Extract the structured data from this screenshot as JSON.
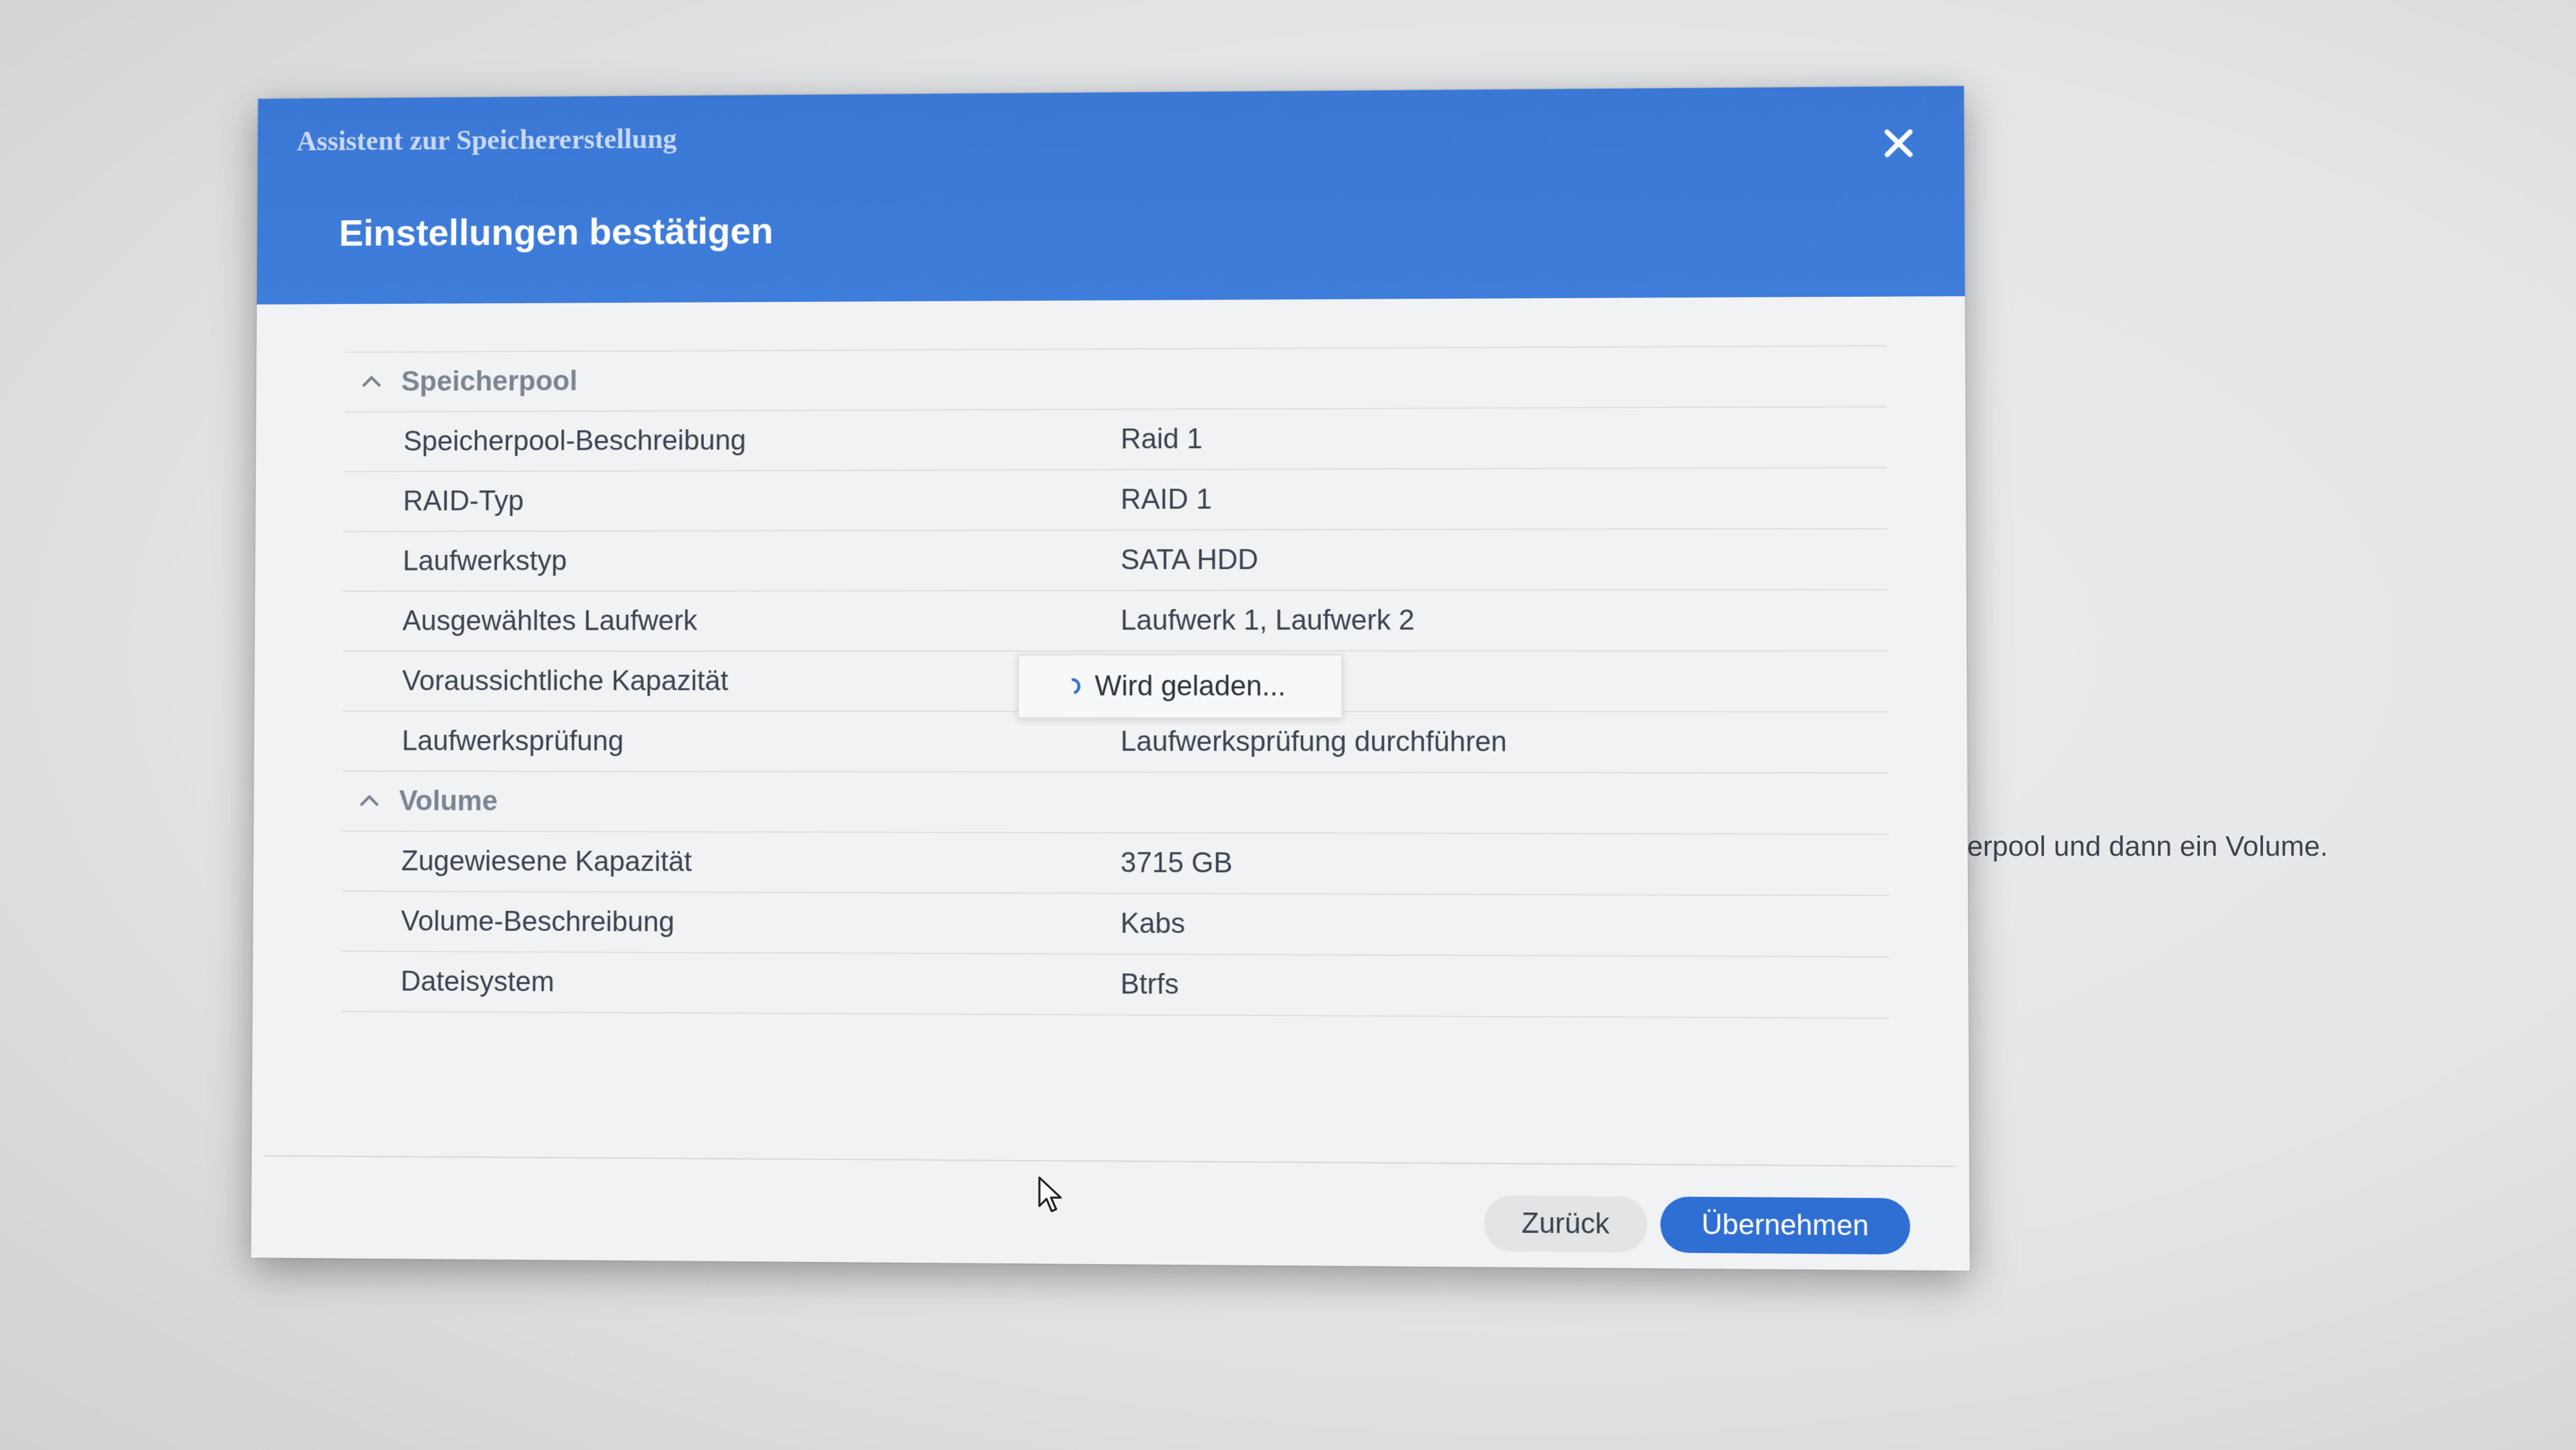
{
  "background": {
    "partial_text": "herpool und dann ein Volume."
  },
  "dialog": {
    "wizard_title": "Assistent zur Speichererstellung",
    "page_title": "Einstellungen bestätigen",
    "close_icon": "close-icon",
    "sections": [
      {
        "title": "Speicherpool",
        "icon": "chevron-up-icon",
        "rows": [
          {
            "label": "Speicherpool-Beschreibung",
            "value": "Raid 1"
          },
          {
            "label": "RAID-Typ",
            "value": "RAID 1"
          },
          {
            "label": "Laufwerkstyp",
            "value": "SATA HDD"
          },
          {
            "label": "Ausgewähltes Laufwerk",
            "value": "Laufwerk 1, Laufwerk 2"
          },
          {
            "label": "Voraussichtliche Kapazität",
            "value": ""
          },
          {
            "label": "Laufwerksprüfung",
            "value": "Laufwerksprüfung durchführen"
          }
        ]
      },
      {
        "title": "Volume",
        "icon": "chevron-up-icon",
        "rows": [
          {
            "label": "Zugewiesene Kapazität",
            "value": "3715 GB"
          },
          {
            "label": "Volume-Beschreibung",
            "value": "Kabs"
          },
          {
            "label": "Dateisystem",
            "value": "Btrfs"
          }
        ]
      }
    ],
    "loading_text": "Wird geladen...",
    "buttons": {
      "back": "Zurück",
      "apply": "Übernehmen"
    },
    "colors": {
      "header": "#3b78d6",
      "primary_button": "#2f6fd3"
    }
  }
}
